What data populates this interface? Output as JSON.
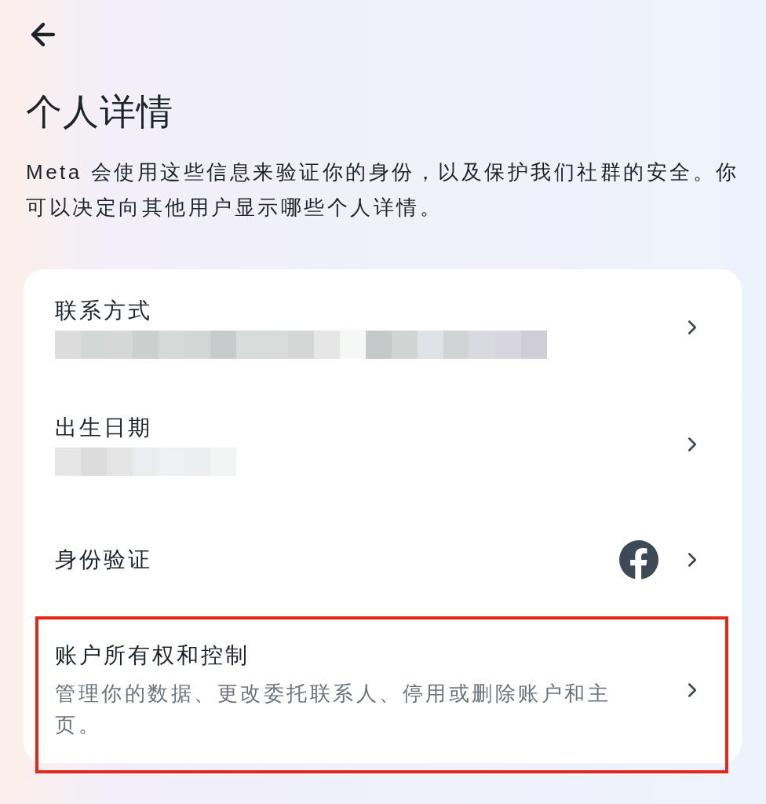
{
  "page": {
    "title": "个人详情",
    "description": "Meta 会使用这些信息来验证你的身份，以及保护我们社群的安全。你可以决定向其他用户显示哪些个人详情。"
  },
  "settings": [
    {
      "kind": "redacted",
      "label": "联系方式",
      "highlighted": false
    },
    {
      "kind": "redacted",
      "label": "出生日期",
      "highlighted": false
    },
    {
      "kind": "linked",
      "label": "身份验证",
      "highlighted": false
    },
    {
      "kind": "described",
      "label": "账户所有权和控制",
      "description": "管理你的数据、更改委托联系人、停用或删除账户和主页。",
      "highlighted": true
    }
  ]
}
